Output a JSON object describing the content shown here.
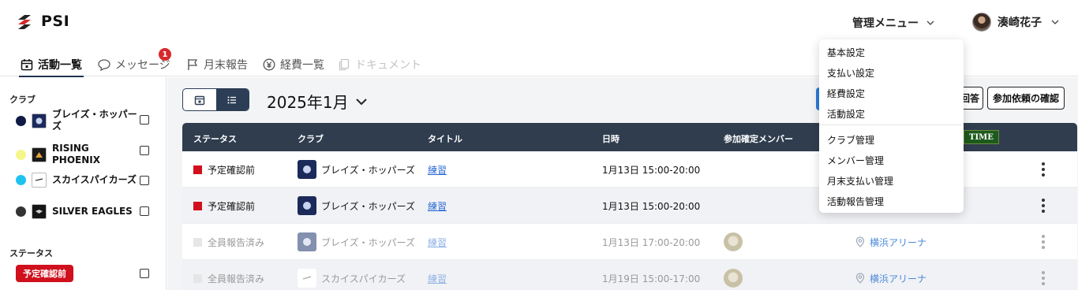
{
  "header": {
    "logo_text": "PSI",
    "admin_menu_label": "管理メニュー",
    "user_name": "湊崎花子"
  },
  "tabs": [
    {
      "label": "活動一覧",
      "icon": "calendar-icon",
      "state": "active"
    },
    {
      "label": "メッセージ",
      "icon": "chat-bubble-icon",
      "state": "normal",
      "badge": "1"
    },
    {
      "label": "月末報告",
      "icon": "flag-icon",
      "state": "normal"
    },
    {
      "label": "経費一覧",
      "icon": "yen-coin-icon",
      "state": "normal"
    },
    {
      "label": "ドキュメント",
      "icon": "documents-icon",
      "state": "disabled"
    }
  ],
  "sidebar": {
    "clubs_heading": "クラブ",
    "clubs": [
      {
        "name": "ブレイズ・ホッパーズ",
        "dot_color": "#0f1a45"
      },
      {
        "name": "RISING PHOENIX",
        "dot_color": "#f6f68a"
      },
      {
        "name": "スカイスパイカーズ",
        "dot_color": "#1fc3f0"
      },
      {
        "name": "SILVER EAGLES",
        "dot_color": "#333333"
      }
    ],
    "status_heading": "ステータス",
    "status_pill": "予定確認前"
  },
  "toolbar": {
    "month_label": "2025年1月",
    "answer_button": "回答",
    "confirm_button": "参加依頼の確認"
  },
  "table": {
    "headers": {
      "status": "ステータス",
      "club": "クラブ",
      "title": "タイトル",
      "datetime": "日時",
      "members": "参加確定メンバー",
      "time_badge": "TIME"
    },
    "rows": [
      {
        "status": "予定確認前",
        "status_color": "#d0101d",
        "club": "ブレイズ・ホッパーズ",
        "title": "練習",
        "datetime": "1月13日 15:00-20:00",
        "location": ""
      },
      {
        "status": "予定確認前",
        "status_color": "#d0101d",
        "club": "ブレイズ・ホッパーズ",
        "title": "練習",
        "datetime": "1月13日 15:00-20:00",
        "location": ""
      },
      {
        "status": "全員報告済み",
        "status_color": "#e6e6e6",
        "club": "ブレイズ・ホッパーズ",
        "title": "練習",
        "datetime": "1月13日 17:00-20:00",
        "location": "横浜アリーナ"
      },
      {
        "status": "全員報告済み",
        "status_color": "#e6e6e6",
        "club": "スカイスパイカーズ",
        "title": "練習",
        "datetime": "1月19日 15:00-17:00",
        "location": "横浜アリーナ"
      }
    ]
  },
  "admin_dropdown": {
    "group1": [
      "基本設定",
      "支払い設定",
      "経費設定",
      "活動設定"
    ],
    "group2": [
      "クラブ管理",
      "メンバー管理",
      "月末支払い管理",
      "活動報告管理"
    ]
  }
}
